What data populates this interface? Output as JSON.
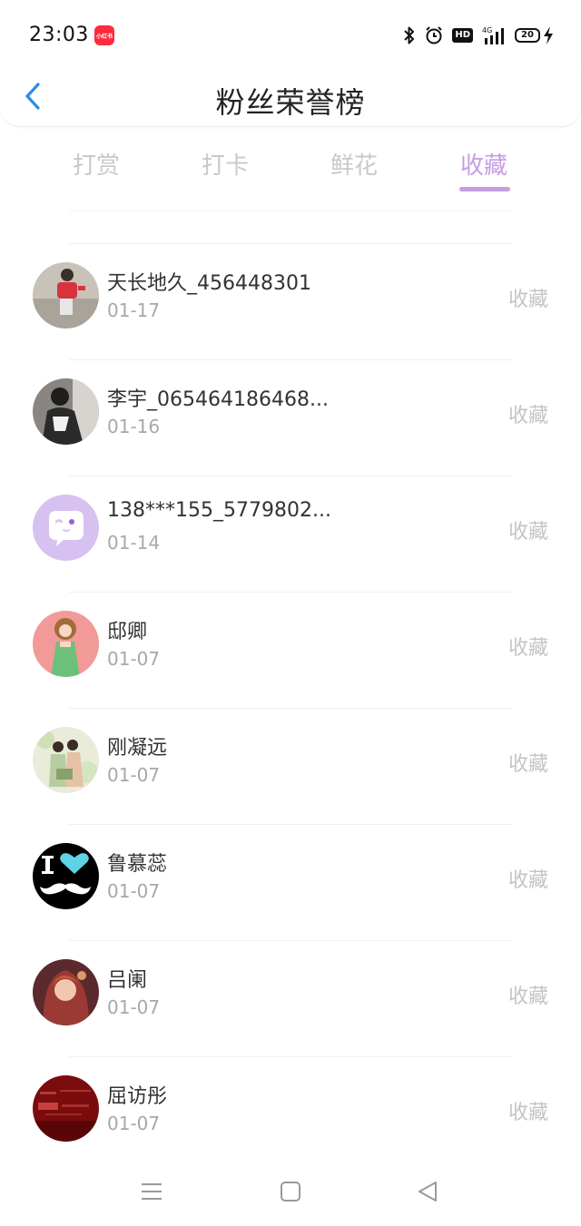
{
  "status_bar": {
    "time": "23:03",
    "app_badge_text": "小红书",
    "signal_label": "4G",
    "battery": "20",
    "icons": [
      "bluetooth-icon",
      "alarm-icon",
      "hd-icon",
      "signal-icon",
      "battery-icon",
      "charging-icon"
    ]
  },
  "header": {
    "title": "粉丝荣誉榜",
    "back_icon": "chevron-left-icon"
  },
  "tabs": [
    {
      "label": "打赏",
      "active": false
    },
    {
      "label": "打卡",
      "active": false
    },
    {
      "label": "鲜花",
      "active": false
    },
    {
      "label": "收藏",
      "active": true
    }
  ],
  "colors": {
    "accent": "#c79de2",
    "tab_inactive": "#c9c9c9",
    "back_icon": "#2b8ce6",
    "date_text": "#a8a8a8",
    "action_text": "#c4c4c4"
  },
  "items": [
    {
      "name": "天长地久_456448301",
      "date": "01-17",
      "action": "收藏",
      "avatar": "photo-child-avatar"
    },
    {
      "name": "李宇_065464186468...",
      "date": "01-16",
      "action": "收藏",
      "avatar": "photo-person-avatar"
    },
    {
      "name": "138***155_5779802...",
      "date": "01-14",
      "action": "收藏",
      "avatar": "default-chat-avatar"
    },
    {
      "name": "邸卿",
      "date": "01-07",
      "action": "收藏",
      "avatar": "illustration-girl-avatar"
    },
    {
      "name": "刚凝远",
      "date": "01-07",
      "action": "收藏",
      "avatar": "illustration-couple-avatar"
    },
    {
      "name": "鲁慕蕊",
      "date": "01-07",
      "action": "收藏",
      "avatar": "heart-mustache-avatar"
    },
    {
      "name": "吕阑",
      "date": "01-07",
      "action": "收藏",
      "avatar": "illustration-woman-avatar"
    },
    {
      "name": "屈访彤",
      "date": "01-07",
      "action": "收藏",
      "avatar": "red-text-avatar"
    }
  ],
  "nav_bar": {
    "icons": [
      "menu-icon",
      "home-icon",
      "back-triangle-icon"
    ]
  }
}
